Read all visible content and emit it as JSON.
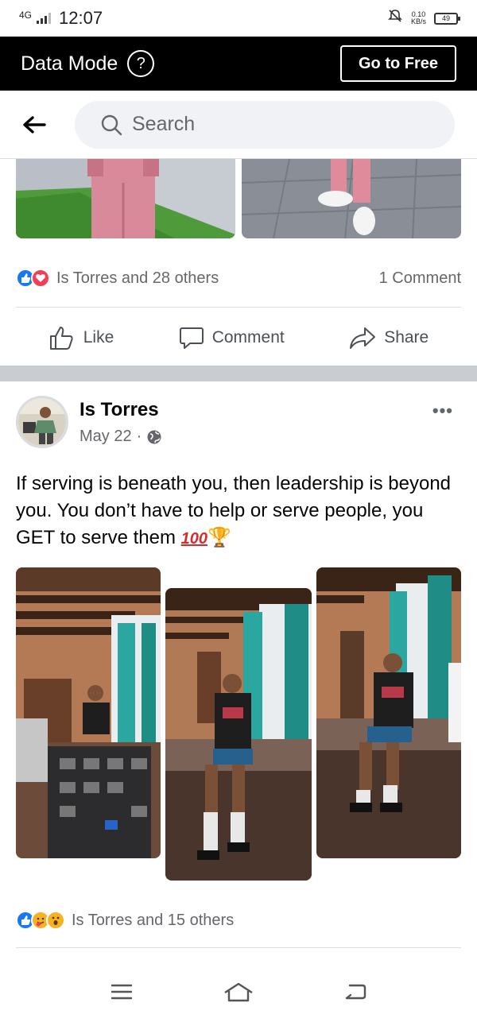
{
  "status_bar": {
    "network": "4G",
    "time": "12:07",
    "speed_value": "0.10",
    "speed_unit": "KB/s",
    "battery": "49"
  },
  "data_mode": {
    "title": "Data Mode",
    "help_icon": "question-circle-icon",
    "go_free_label": "Go to Free"
  },
  "search": {
    "back_icon": "back-arrow-icon",
    "placeholder": "Search"
  },
  "previous_post": {
    "reactions_text": "Is Torres and 28 others",
    "comments_text": "1 Comment",
    "actions": {
      "like": "Like",
      "comment": "Comment",
      "share": "Share"
    }
  },
  "post": {
    "author": "Is Torres",
    "date": "May 22",
    "dot": "·",
    "privacy_icon": "globe-icon",
    "more_icon": "more-dots-icon",
    "more_label": "•••",
    "text": "If serving is beneath you, then leadership is beyond you. You don’t have to help or serve people, you GET to serve them",
    "emoji_100": "100",
    "emoji_trophy": "🏆",
    "reactions_text": "Is Torres and 15 others"
  },
  "colors": {
    "facebook_blue": "#1877f2",
    "love_red": "#f33e58",
    "haha_yellow": "#f7b125",
    "separator_gray": "#c9ccd1"
  }
}
